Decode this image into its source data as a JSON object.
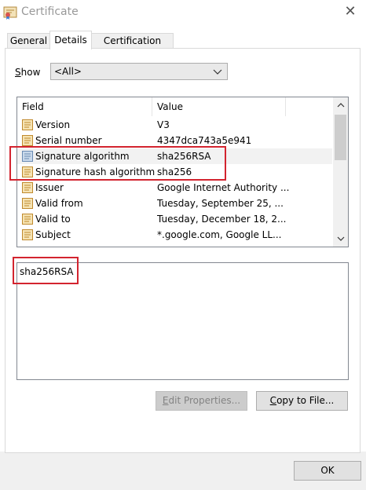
{
  "window": {
    "title": "Certificate",
    "icon": "certificate-icon",
    "close_glyph": "✕"
  },
  "tabs": [
    {
      "label": "General",
      "active": false
    },
    {
      "label": "Details",
      "active": true
    },
    {
      "label": "Certification Path",
      "active": false
    }
  ],
  "show": {
    "label_pre": "",
    "label_accel": "S",
    "label_post": "how",
    "selected": "<All>"
  },
  "list": {
    "columns": [
      "Field",
      "Value"
    ],
    "rows": [
      {
        "field": "Version",
        "value": "V3",
        "icon": "cert-field-icon"
      },
      {
        "field": "Serial number",
        "value": "4347dca743a5e941",
        "icon": "cert-field-icon"
      },
      {
        "field": "Signature algorithm",
        "value": "sha256RSA",
        "icon": "cert-field-icon",
        "selected": true
      },
      {
        "field": "Signature hash algorithm",
        "value": "sha256",
        "icon": "cert-field-icon"
      },
      {
        "field": "Issuer",
        "value": "Google Internet Authority ...",
        "icon": "cert-field-icon"
      },
      {
        "field": "Valid from",
        "value": "Tuesday, September 25, ...",
        "icon": "cert-field-icon"
      },
      {
        "field": "Valid to",
        "value": "Tuesday, December 18, 2...",
        "icon": "cert-field-icon"
      },
      {
        "field": "Subject",
        "value": "*.google.com, Google LL...",
        "icon": "cert-field-icon"
      }
    ]
  },
  "detail_value": "sha256RSA",
  "buttons": {
    "edit_accel": "E",
    "edit_rest": "dit Properties...",
    "copy_accel": "C",
    "copy_rest": "opy to File...",
    "ok": "OK"
  },
  "colors": {
    "highlight": "#d3242f",
    "selected_row": "#f2f2f2"
  }
}
